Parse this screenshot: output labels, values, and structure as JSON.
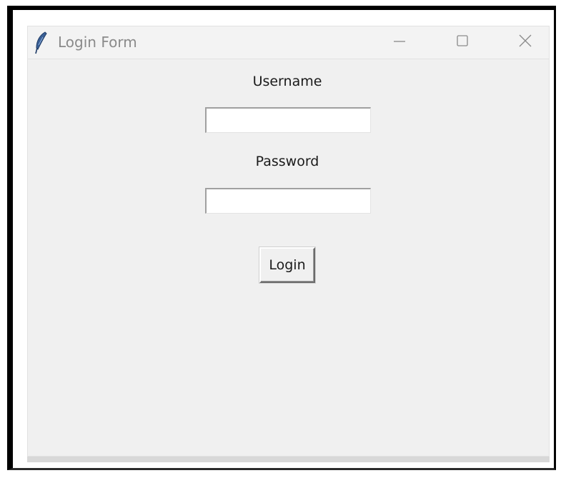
{
  "window": {
    "title": "Login Form",
    "controls": {
      "minimize_icon": "minimize-icon",
      "maximize_icon": "maximize-icon",
      "close_icon": "close-icon"
    },
    "app_icon": "feather-icon"
  },
  "form": {
    "username_label": "Username",
    "username_value": "",
    "password_label": "Password",
    "password_value": "",
    "login_label": "Login"
  },
  "colors": {
    "window_bg": "#f0f0f0",
    "titlebar_bg": "#f3f3f3",
    "title_text": "#8a8a8a",
    "feather_icon": "#3a5f95"
  }
}
